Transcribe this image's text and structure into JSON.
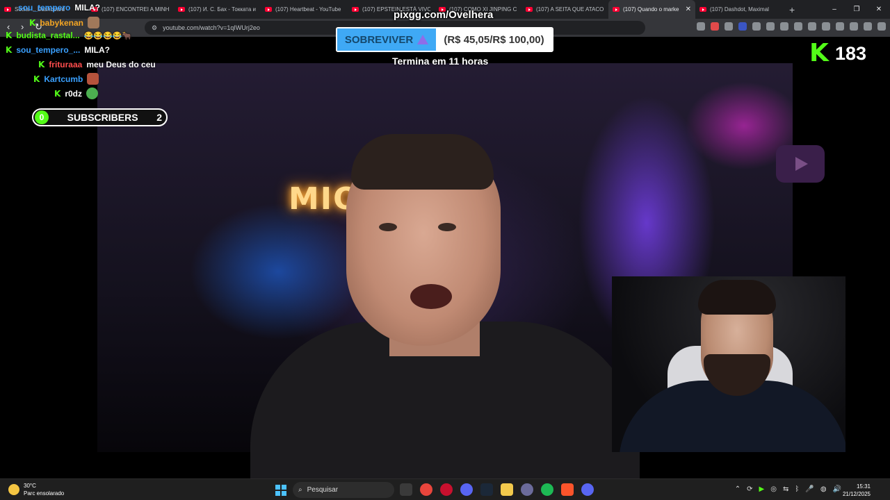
{
  "browser": {
    "tabs": [
      {
        "title": "Social ... Dashboard",
        "active": false
      },
      {
        "title": "(107) ENCONTREI A MINH",
        "active": false
      },
      {
        "title": "(107) И. С. Бах - Токката и",
        "active": false
      },
      {
        "title": "(107) Heartbeat - YouTube",
        "active": false
      },
      {
        "title": "(107) EPSTEIN ESTÁ VIVO",
        "active": false
      },
      {
        "title": "(107) COMO XI JINPING C",
        "active": false
      },
      {
        "title": "(107) A SEITA QUE ATACO",
        "active": false
      },
      {
        "title": "(107) Quando o marke",
        "active": true
      },
      {
        "title": "(107) Dashdot, Maximal",
        "active": false
      }
    ],
    "new_tab": "+",
    "window_controls": {
      "minimize": "–",
      "maximize": "❐",
      "close": "✕"
    },
    "nav": {
      "back": "‹",
      "forward": "›",
      "reload": "↻"
    },
    "address": "youtube.com/watch?v=1qIWUrj2eo"
  },
  "overlay": {
    "pix_url": "pixgg.com/Ovelhera",
    "goal": {
      "label": "SOBREVIVER",
      "amount": "(R$ 45,05/R$ 100,00)",
      "subtitle": "Termina em 11 horas"
    },
    "viewer_count": "183",
    "subscribers": {
      "left": "0",
      "label": "SUBSCRIBERS",
      "right": "2"
    }
  },
  "chat": [
    {
      "user": "sou_tempero",
      "user_color": "#3aa0ff",
      "text": "MILA?"
    },
    {
      "user": "babykenan",
      "user_color": "#f5a623",
      "text": ""
    },
    {
      "user": "budista_rastal...",
      "user_color": "#53fc18",
      "text": "😂😂😂😂🐂"
    },
    {
      "user": "sou_tempero_...",
      "user_color": "#3aa0ff",
      "text": "MILA?"
    },
    {
      "user": "frituraaa",
      "user_color": "#ff4d4d",
      "text": "meu Deus do ceu"
    },
    {
      "user": "Kartcumb",
      "user_color": "#3aa0ff",
      "text": ""
    },
    {
      "user": "r0dz",
      "user_color": "#ffffff",
      "text": ""
    }
  ],
  "video": {
    "sign_text": "MIOPIA"
  },
  "taskbar": {
    "weather_temp": "30°C",
    "weather_desc": "Parc ensolarado",
    "search_placeholder": "Pesquisar",
    "time": "15:31",
    "date": "21/12/2025",
    "tray_up": "⌃"
  },
  "colors": {
    "kick_green": "#53fc18",
    "goal_blue": "#3fa9f5",
    "youtube_red": "#ff0033"
  }
}
